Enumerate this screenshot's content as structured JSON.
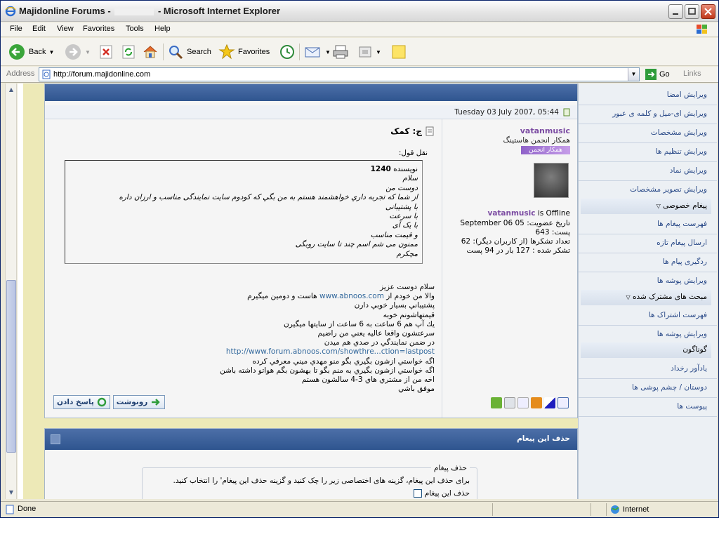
{
  "window": {
    "title_left": "Majidonline Forums -",
    "title_right": "- Microsoft Internet Explorer"
  },
  "menu": [
    "File",
    "Edit",
    "View",
    "Favorites",
    "Tools",
    "Help"
  ],
  "toolbar": {
    "back": "Back",
    "search": "Search",
    "favorites": "Favorites"
  },
  "address": {
    "label": "Address",
    "url": "http://forum.majidonline.com",
    "go": "Go",
    "links": "Links"
  },
  "status": {
    "text": "Done",
    "zone": "Internet"
  },
  "sidebar": {
    "items_top": [
      "ویرایش امضا",
      "ویرایش ای-میل و کلمه ی عبور",
      "ویرایش مشخصات",
      "ویرایش تنظیم ها",
      "ویرایش نماد",
      "ویرایش تصویر مشخصات"
    ],
    "pm_head": "پیغام خصوصی",
    "pm_items": [
      "فهرست پیغام ها",
      "ارسال پیغام تازه",
      "ردگیری پیام ها",
      "ویرایش پوشه ها"
    ],
    "subs_head": "مبحث های مشترک شده",
    "subs_items": [
      "فهرست اشتراک ها",
      "ویرایش پوشه ها"
    ],
    "misc_head": "گوناگون",
    "misc_items": [
      "یادآور رخداد",
      "دوستان / چشم پوشی ها",
      "پیوست ها"
    ]
  },
  "post": {
    "date": "Tuesday 03 July 2007, 05:44",
    "title": "ج: کمک",
    "quote_label": "نقل قول:",
    "quote_author_prefix": "نویسنده",
    "quote_author": "1240",
    "quote_lines": [
      "سلام",
      "دوست من",
      "از شما که تجربه داري خواهشمند هستم به من بگي که كودوم سایت نمایندگی مناسب و ارزان داره",
      "با پشتیبانی",
      "با سرعت",
      "با یک آی",
      "و قیمت مناسب",
      "ممنون می شم اسم چند تا سایت روبگی",
      "مچکرم"
    ],
    "body_lines": [
      {
        "t": "سلام دوست عزیز"
      },
      {
        "t": "والا من خودم از ",
        "link": "www.abnoos.com",
        "t2": " هاست و دومین میگیرم"
      },
      {
        "t": "پشتیباني بسيار خوبي دارن"
      },
      {
        "t": "قيمتهاشونم خوبه"
      },
      {
        "t": "يك آپ هم 6 ساعت به 6 ساعت از سايتها ميگيرن"
      },
      {
        "t": "سرعتشون واقعا عاليه يعني من راضيم"
      },
      {
        "t": "در ضمن نمايندگي در صدي هم ميدن"
      },
      {
        "link": "http://www.forum.abnoos.com/showthre...ction=lastpost"
      },
      {
        "t": "اگه خواستي ازشون بگيري بگو منو مهدي ميني معرفي كرده"
      },
      {
        "t": "اگه خواستي ازشون بگيري به منم بگو تا بهشون بگم هواتو داشته باشن"
      },
      {
        "t": "اخه من از مشتري هاي 3-4 سالشون هستم"
      },
      {
        "t": "موفق باشي"
      }
    ],
    "reply_btn": "پاسخ دادن",
    "quote_btn": "رونوشت",
    "user": {
      "name": "vatanmusic",
      "title": "همکار انجمن هاستینگ",
      "rank": "همکار انجمن",
      "online_name": "vatanmusic",
      "online_text": "is Offline",
      "stats": [
        "تاریخ عضویت: September 06 05",
        "پست: 643",
        "تعداد تشکرها (از کاربران دیگر): 62",
        "تشکر شده : 127 بار در 94 پست"
      ]
    }
  },
  "delete": {
    "header": "حذف این پیغام",
    "legend": "حذف پیغام",
    "desc": "برای حذف این پیغام، گزینه های اختصاصی زیر را چک کنید و گزینه حذف این پیغام' را انتخاب کنید.",
    "checkbox": "حذف این پیغام"
  },
  "colors": {
    "accent": "#2f558f",
    "link": "#33699d",
    "username": "#7b4ba2"
  }
}
